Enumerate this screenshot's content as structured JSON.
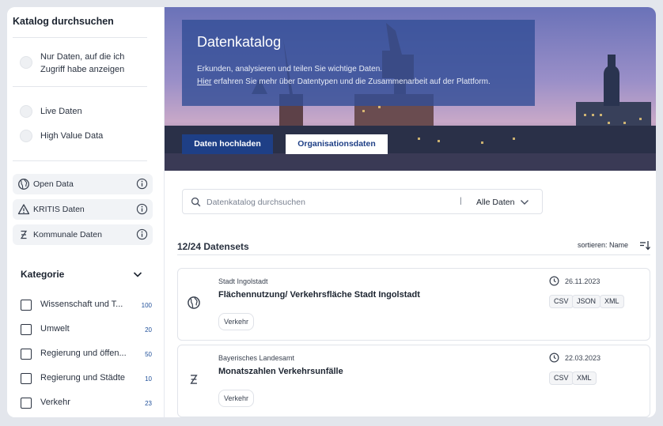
{
  "sidebar": {
    "title": "Katalog durchsuchen",
    "filters": [
      {
        "label_line1": "Nur Daten, auf die ich",
        "label_line2": "Zugriff habe anzeigen"
      },
      {
        "label": "Live Daten"
      },
      {
        "label": "High Value Data"
      }
    ],
    "chips": [
      {
        "label": "Open Data",
        "icon": "globe-icon"
      },
      {
        "label": "KRITIS Daten",
        "icon": "warning-icon"
      },
      {
        "label": "Kommunale Daten",
        "icon": "kommunal-icon"
      }
    ],
    "category": {
      "title": "Kategorie",
      "items": [
        {
          "label": "Wissenschaft und T...",
          "count": "100"
        },
        {
          "label": "Umwelt",
          "count": "20"
        },
        {
          "label": "Regierung und öffen...",
          "count": "50"
        },
        {
          "label": "Regierung und Städte",
          "count": "10"
        },
        {
          "label": "Verkehr",
          "count": "23"
        }
      ]
    }
  },
  "hero": {
    "title": "Datenkatalog",
    "text1": "Erkunden, analysieren und teilen Sie wichtige Daten.",
    "text2_link": "Hier",
    "text2_rest": " erfahren Sie mehr über Datentypen und die Zusammenarbeit auf der Plattform.",
    "upload_button": "Daten hochladen",
    "org_button": "Organisationsdaten"
  },
  "search": {
    "placeholder": "Datenkatalog durchsuchen",
    "separator": "|",
    "selected": "Alle Daten"
  },
  "results": {
    "count": "12/24 Datensets",
    "sort_prefix": "sortieren:",
    "sort_value": "Name"
  },
  "cards": [
    {
      "org": "Stadt Ingolstadt",
      "title": "Flächennutzung/ Verkehrsfläche Stadt Ingolstadt",
      "tag": "Verkehr",
      "date": "26.11.2023",
      "formats": [
        "CSV",
        "JSON",
        "XML"
      ],
      "icon": "globe-icon"
    },
    {
      "org": "Bayerisches Landesamt",
      "title": "Monatszahlen Verkehrsunfälle",
      "tag": "Verkehr",
      "date": "22.03.2023",
      "formats": [
        "CSV",
        "XML"
      ],
      "icon": "kommunal-icon"
    }
  ],
  "colors": {
    "primary": "#1e3f86",
    "hero_overlay": "#324e96",
    "count_blue": "#1f4f99"
  }
}
